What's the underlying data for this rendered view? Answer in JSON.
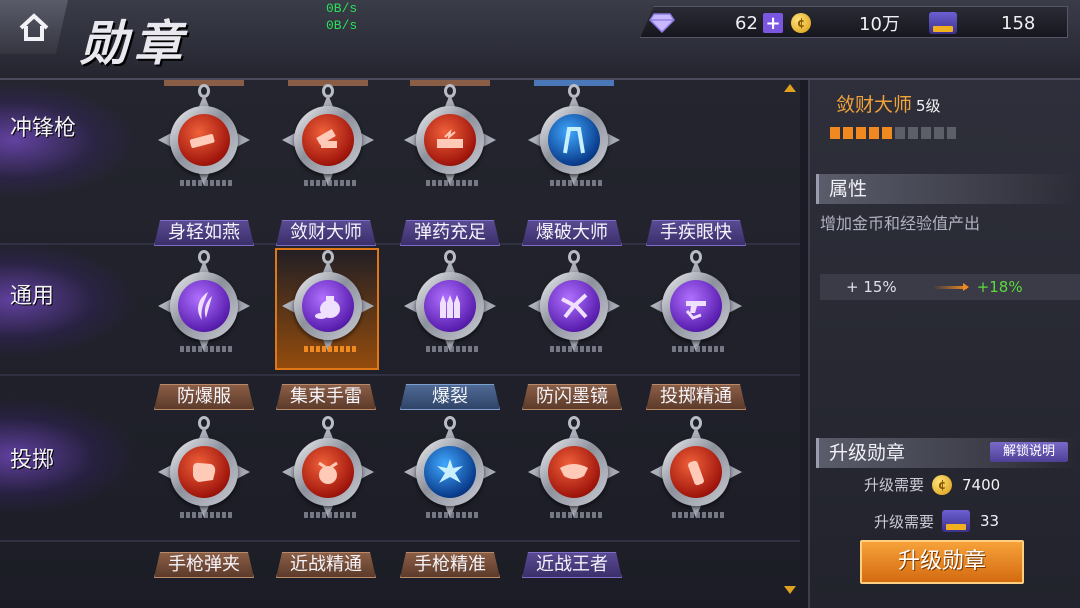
{
  "header": {
    "title": "勋章",
    "net_up": "0B/s",
    "net_down": "0B/s",
    "diamonds": "62",
    "gold": "10万",
    "merit": "158"
  },
  "sections": [
    {
      "label": "冲锋枪",
      "medals": [
        "red",
        "red",
        "red",
        "blue"
      ],
      "tags_peek": [
        "bronze",
        "bronze",
        "bronze",
        "blue"
      ]
    },
    {
      "label": "通用",
      "tags": [
        "身轻如燕",
        "敛财大师",
        "弹药充足",
        "爆破大师",
        "手疾眼快"
      ],
      "tag_styles": [
        "purple",
        "purple",
        "purple",
        "purple",
        "purple"
      ],
      "medals": [
        "purple",
        "purple",
        "purple",
        "purple",
        "purple"
      ]
    },
    {
      "label": "投掷",
      "tags": [
        "防爆服",
        "集束手雷",
        "爆裂",
        "防闪墨镜",
        "投掷精通"
      ],
      "tag_styles": [
        "bronze",
        "bronze",
        "blue",
        "bronze",
        "bronze"
      ],
      "medals": [
        "red",
        "red",
        "blue",
        "red",
        "red"
      ]
    },
    {
      "tags": [
        "手枪弹夹",
        "近战精通",
        "手枪精准",
        "近战王者"
      ],
      "tag_styles": [
        "bronze",
        "bronze",
        "bronze",
        "purple"
      ]
    }
  ],
  "detail": {
    "name": "敛财大师",
    "level": "5级",
    "progress": 0.5,
    "attr_heading": "属性",
    "attr_desc": "增加金币和经验值产出",
    "attr_current": "+ 15%",
    "attr_next": "+18%",
    "upgrade_heading": "升级勋章",
    "unlock_label": "解锁说明",
    "req_gold_label": "升级需要",
    "req_gold_value": "7400",
    "req_merit_label": "升级需要",
    "req_merit_value": "33",
    "upgrade_button": "升级勋章"
  },
  "colors": {
    "accent": "#f08a20",
    "gain": "#5adc3c",
    "purple": "#7b56e0"
  }
}
